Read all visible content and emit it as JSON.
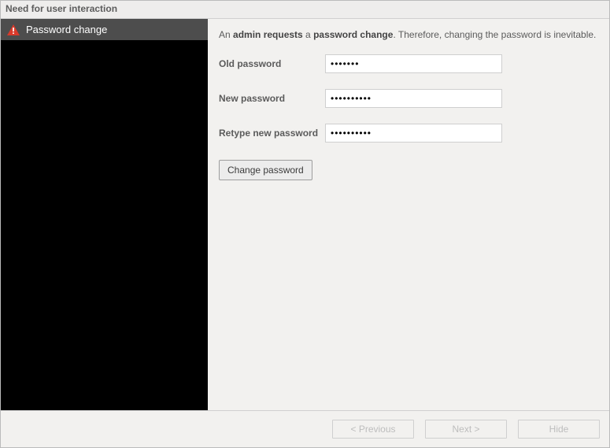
{
  "window": {
    "title": "Need for user interaction"
  },
  "sidebar": {
    "items": [
      {
        "label": "Password change",
        "icon": "alert-icon"
      }
    ]
  },
  "main": {
    "prompt_parts": {
      "p1": "An ",
      "b1": "admin requests",
      "p2": " a ",
      "b2": "password change",
      "p3": ". Therefore, changing the password is inevitable."
    },
    "fields": {
      "old_password": {
        "label": "Old password",
        "value": "•••••••"
      },
      "new_password": {
        "label": "New password",
        "value": "••••••••••"
      },
      "retype_password": {
        "label": "Retype new password",
        "value": "••••••••••"
      }
    },
    "change_button": "Change password"
  },
  "footer": {
    "previous": "< Previous",
    "next": "Next >",
    "hide": "Hide"
  }
}
